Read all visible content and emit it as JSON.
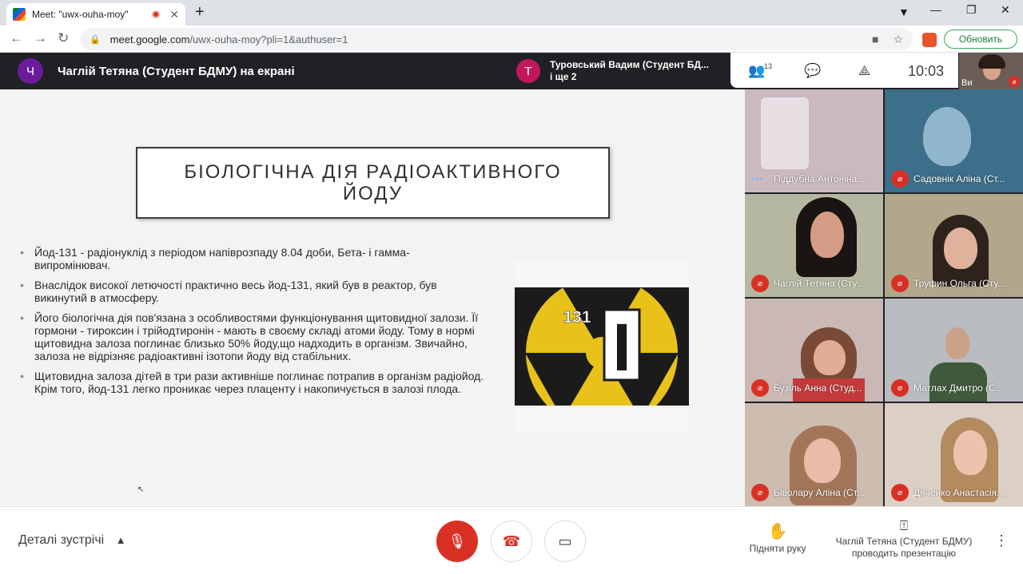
{
  "browser": {
    "tab_title": "Meet: \"uwx-ouha-moy\"",
    "new_tab": "+",
    "url_host": "meet.google.com",
    "url_path": "/uwx-ouha-moy?pli=1&authuser=1",
    "update_label": "Обновить"
  },
  "meet": {
    "presenter_initial": "Ч",
    "presenter_text": "Чаглій Тетяна (Студент БДМУ) на екрані",
    "notice_initial": "Т",
    "notice_line1": "Туровський Вадим (Студент БД...",
    "notice_line2": "і ще 2",
    "participant_count": "13",
    "time": "10:03",
    "self_label": "Ви",
    "accent_presenter": "#6a1b9a",
    "accent_notice": "#c2185b"
  },
  "slide": {
    "title": "БІОЛОГІЧНА ДІЯ РАДІОАКТИВНОГО ЙОДУ",
    "bullets": [
      "Йод-131 - радіонуклід з періодом напіврозпаду 8.04 доби, Бета- і гамма- випромінювач.",
      "Внаслідок високої летючості практично весь йод-131, який  був в реактор, був викинутий в атмосферу.",
      " Його біологічна дія пов'язана з особливостями функціонування щитовидної залози. Її гормони - тироксин і трійодтиронін - мають в своєму складі атоми йоду. Тому в нормі щитовидна залоза поглинає близько 50% йоду,що надходить в організм. Звичайно, залоза не відрізняє радіоактивні ізотопи йоду від стабільних.",
      "Щитовидна залоза дітей в три рази активніше поглинає потрапив в організм радіойод. Крім того, йод-131 легко проникає через плаценту і накопичується в залозі плода."
    ],
    "image_number": "131",
    "image_letter": "I"
  },
  "participants": [
    {
      "name": "Піддубна Антоніна...",
      "state": "speaking"
    },
    {
      "name": "Садовнік Аліна (Ст...",
      "state": "muted"
    },
    {
      "name": "Чаглій Тетяна (Сту...",
      "state": "muted"
    },
    {
      "name": "Труфин Ольга (Сту...",
      "state": "muted"
    },
    {
      "name": "Бузіль Анна (Студ...",
      "state": "muted"
    },
    {
      "name": "Матлах Дмитро (С...",
      "state": "muted"
    },
    {
      "name": "Біволару Аліна (Ст...",
      "state": "muted"
    },
    {
      "name": "Дяченко Анастасія...",
      "state": "muted"
    }
  ],
  "bottom": {
    "details_label": "Деталі зустрічі",
    "raise_hand_label": "Підняти руку",
    "presenting_line1": "Чаглій Тетяна (Студент БДМУ)",
    "presenting_line2": "проводить презентацію"
  }
}
